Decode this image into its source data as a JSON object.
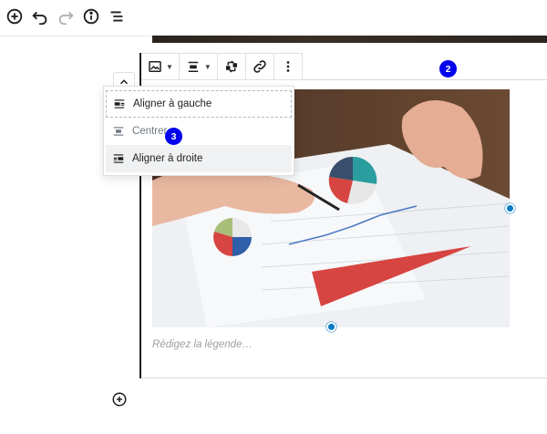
{
  "top_toolbar": {
    "icons": [
      "plus-circle-icon",
      "undo-icon",
      "redo-icon",
      "info-icon",
      "list-outline-icon"
    ]
  },
  "block_toolbar": {
    "icons": [
      "image-icon",
      "align-center-icon",
      "replace-icon",
      "link-icon",
      "more-vertical-icon"
    ]
  },
  "align_menu": {
    "items": [
      {
        "label": "Aligner à gauche",
        "icon": "align-left-icon"
      },
      {
        "label": "Centrer",
        "icon": "align-center-icon"
      },
      {
        "label": "Aligner à droite",
        "icon": "align-right-icon"
      }
    ]
  },
  "caption": {
    "placeholder": "Rédigez la légende…"
  },
  "badges": {
    "toolbar_step": "2",
    "menu_step": "3"
  },
  "colors": {
    "accent": "#0a7bc2",
    "badge": "#0000ee",
    "pie_red": "#d64541",
    "pie_teal": "#2a9d9f"
  }
}
